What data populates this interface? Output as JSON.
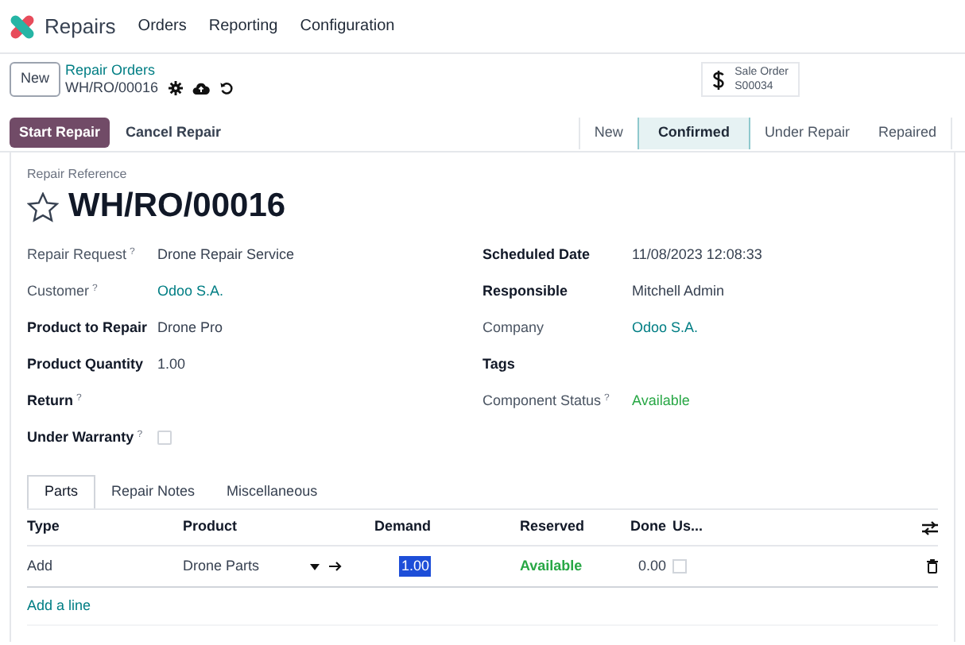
{
  "app": {
    "name": "Repairs",
    "menu": [
      "Orders",
      "Reporting",
      "Configuration"
    ]
  },
  "control_panel": {
    "new_button": "New",
    "breadcrumb": "Repair Orders",
    "record": "WH/RO/00016"
  },
  "smart_button": {
    "label": "Sale Order",
    "value": "S00034"
  },
  "actions": [
    {
      "label": "Start Repair",
      "primary": true
    },
    {
      "label": "Cancel Repair",
      "primary": false
    }
  ],
  "stages": [
    {
      "label": "New",
      "selected": false
    },
    {
      "label": "Confirmed",
      "selected": true
    },
    {
      "label": "Under Repair",
      "selected": false
    },
    {
      "label": "Repaired",
      "selected": false
    }
  ],
  "form": {
    "reference_label": "Repair Reference",
    "title": "WH/RO/00016",
    "starred": false,
    "left_fields": [
      {
        "label": "Repair Request",
        "required": false,
        "help": "?",
        "kind": "text",
        "value": "Drone Repair Service"
      },
      {
        "label": "Customer",
        "required": false,
        "help": "?",
        "kind": "link",
        "value": "Odoo S.A."
      },
      {
        "label": "Product to Repair",
        "required": true,
        "kind": "text",
        "value": "Drone Pro"
      },
      {
        "label": "Product Quantity",
        "required": true,
        "kind": "text",
        "value": "1.00"
      },
      {
        "label": "Return",
        "required": true,
        "help": "?",
        "kind": "empty"
      },
      {
        "label": "Under Warranty",
        "required": true,
        "help": "?",
        "kind": "checkbox",
        "checked": false
      }
    ],
    "right_fields": [
      {
        "label": "Scheduled Date",
        "required": true,
        "kind": "text",
        "value": "11/08/2023 12:08:33"
      },
      {
        "label": "Responsible",
        "required": true,
        "kind": "text",
        "value": "Mitchell Admin"
      },
      {
        "label": "Company",
        "required": false,
        "kind": "link",
        "value": "Odoo S.A."
      },
      {
        "label": "Tags",
        "required": true,
        "kind": "empty"
      },
      {
        "label": "Component Status",
        "required": false,
        "help": "?",
        "kind": "status",
        "value": "Available"
      }
    ]
  },
  "tabs": [
    {
      "label": "Parts",
      "selected": true
    },
    {
      "label": "Repair Notes",
      "selected": false
    },
    {
      "label": "Miscellaneous",
      "selected": false
    }
  ],
  "table": {
    "columns": [
      "Type",
      "Product",
      "Demand",
      "Reserved",
      "Done",
      "Us..."
    ],
    "rows": [
      {
        "type": "Add",
        "product": "Drone Parts",
        "demand": "1.00",
        "reserved": "Available",
        "done": "0.00",
        "used": false
      }
    ],
    "add_line": "Add a line"
  }
}
